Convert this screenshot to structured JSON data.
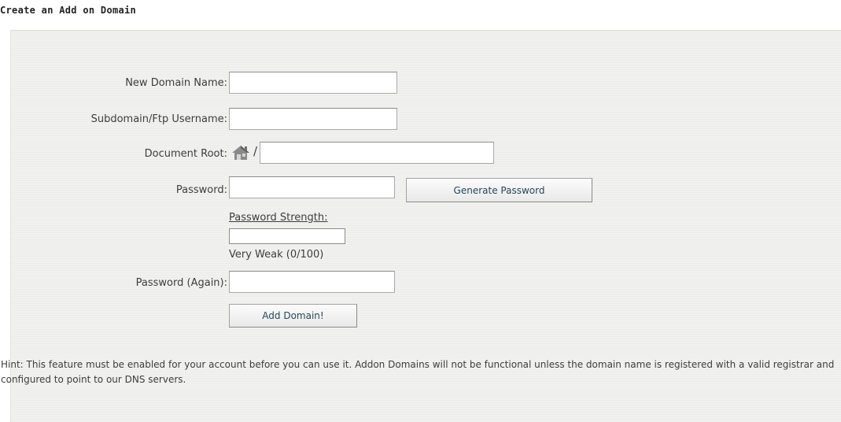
{
  "page": {
    "title": "Create an Add on Domain"
  },
  "form": {
    "new_domain": {
      "label": "New Domain Name:",
      "value": ""
    },
    "subdomain": {
      "label": "Subdomain/Ftp Username:",
      "value": ""
    },
    "document_root": {
      "label": "Document Root:",
      "prefix": "/",
      "value": "",
      "icon": "home-icon"
    },
    "password": {
      "label": "Password:",
      "value": ""
    },
    "generate_password_label": "Generate Password",
    "strength": {
      "label": "Password Strength:",
      "text": "Very Weak (0/100)",
      "score": 0
    },
    "password_again": {
      "label": "Password (Again):",
      "value": ""
    },
    "submit_label": "Add Domain!"
  },
  "hint": "Hint: This feature must be enabled for your account before you can use it. Addon Domains will not be functional unless the domain name is registered with a valid registrar and configured to point to our DNS servers.",
  "colors": {
    "panel_background": "#f1f1ef",
    "button_text": "#1f4a5a"
  }
}
